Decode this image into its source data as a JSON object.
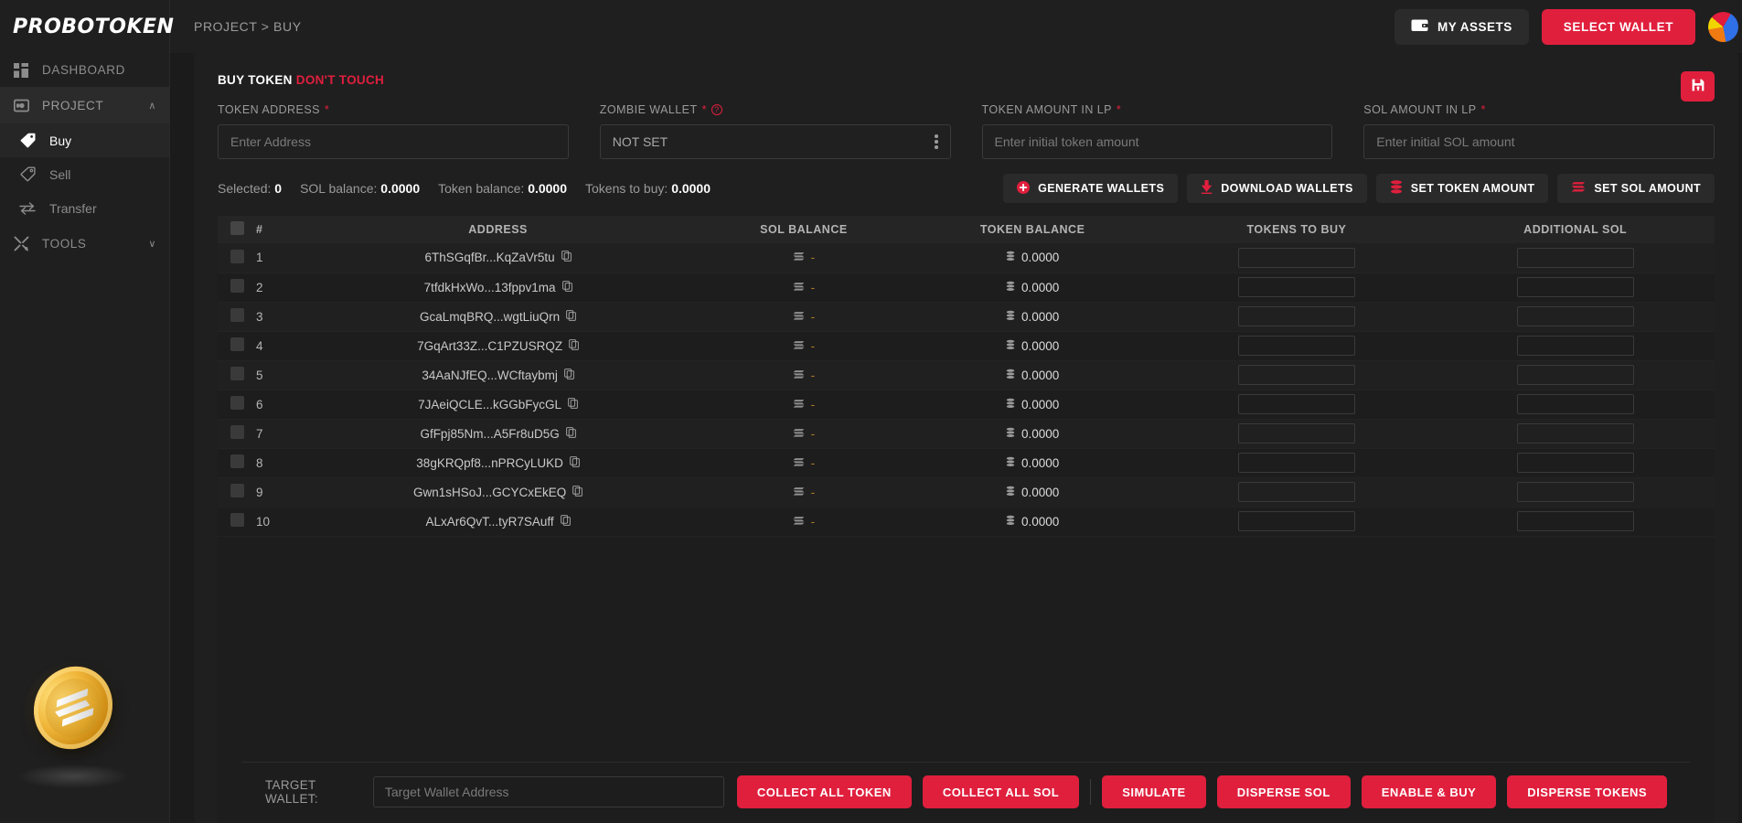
{
  "sidebar": {
    "logo": "PROBOTOKEN",
    "items": [
      {
        "label": "DASHBOARD",
        "icon": "grid-icon"
      },
      {
        "label": "PROJECT",
        "icon": "project-icon",
        "chevron": "∧"
      },
      {
        "label": "TOOLS",
        "icon": "tools-icon",
        "chevron": "∨"
      }
    ],
    "sub_items": [
      {
        "label": "Buy",
        "icon": "tag-filled-icon"
      },
      {
        "label": "Sell",
        "icon": "tag-outline-icon"
      },
      {
        "label": "Transfer",
        "icon": "transfer-icon"
      }
    ],
    "coin": "solana-coin-graphic"
  },
  "topbar": {
    "breadcrumb": "PROJECT > BUY",
    "my_assets_label": "MY ASSETS",
    "select_wallet_label": "SELECT WALLET"
  },
  "panel": {
    "title": "BUY TOKEN",
    "title_warning": "DON'T TOUCH",
    "save_icon": "save-floppy-icon"
  },
  "form": {
    "token_address": {
      "label": "TOKEN ADDRESS",
      "required": "*",
      "placeholder": "Enter Address",
      "value": ""
    },
    "zombie_wallet": {
      "label": "ZOMBIE WALLET",
      "required": "*",
      "value": "NOT SET",
      "help": "?"
    },
    "token_amount_lp": {
      "label": "TOKEN AMOUNT IN LP",
      "required": "*",
      "placeholder": "Enter initial token amount",
      "value": ""
    },
    "sol_amount_lp": {
      "label": "SOL AMOUNT IN LP",
      "required": "*",
      "placeholder": "Enter initial SOL amount",
      "value": ""
    }
  },
  "stats": {
    "selected_label": "Selected:",
    "selected_value": "0",
    "sol_balance_label": "SOL balance:",
    "sol_balance_value": "0.0000",
    "token_balance_label": "Token balance:",
    "token_balance_value": "0.0000",
    "tokens_to_buy_label": "Tokens to buy:",
    "tokens_to_buy_value": "0.0000"
  },
  "tool_buttons": [
    {
      "label": "GENERATE WALLETS",
      "icon": "plus-circle-icon"
    },
    {
      "label": "DOWNLOAD WALLETS",
      "icon": "download-icon"
    },
    {
      "label": "SET TOKEN AMOUNT",
      "icon": "coins-icon"
    },
    {
      "label": "SET SOL AMOUNT",
      "icon": "solana-icon"
    }
  ],
  "table": {
    "columns": [
      "#",
      "ADDRESS",
      "SOL BALANCE",
      "TOKEN BALANCE",
      "TOKENS TO BUY",
      "ADDITIONAL SOL"
    ],
    "rows": [
      {
        "num": "1",
        "address": "6ThSGqfBr...KqZaVr5tu",
        "sol_balance": "-",
        "token_balance": "0.0000",
        "tokens_to_buy": "",
        "additional_sol": ""
      },
      {
        "num": "2",
        "address": "7tfdkHxWo...13fppv1ma",
        "sol_balance": "-",
        "token_balance": "0.0000",
        "tokens_to_buy": "",
        "additional_sol": ""
      },
      {
        "num": "3",
        "address": "GcaLmqBRQ...wgtLiuQrn",
        "sol_balance": "-",
        "token_balance": "0.0000",
        "tokens_to_buy": "",
        "additional_sol": ""
      },
      {
        "num": "4",
        "address": "7GqArt33Z...C1PZUSRQZ",
        "sol_balance": "-",
        "token_balance": "0.0000",
        "tokens_to_buy": "",
        "additional_sol": ""
      },
      {
        "num": "5",
        "address": "34AaNJfEQ...WCftaybmj",
        "sol_balance": "-",
        "token_balance": "0.0000",
        "tokens_to_buy": "",
        "additional_sol": ""
      },
      {
        "num": "6",
        "address": "7JAeiQCLE...kGGbFycGL",
        "sol_balance": "-",
        "token_balance": "0.0000",
        "tokens_to_buy": "",
        "additional_sol": ""
      },
      {
        "num": "7",
        "address": "GfFpj85Nm...A5Fr8uD5G",
        "sol_balance": "-",
        "token_balance": "0.0000",
        "tokens_to_buy": "",
        "additional_sol": ""
      },
      {
        "num": "8",
        "address": "38gKRQpf8...nPRCyLUKD",
        "sol_balance": "-",
        "token_balance": "0.0000",
        "tokens_to_buy": "",
        "additional_sol": ""
      },
      {
        "num": "9",
        "address": "Gwn1sHSoJ...GCYCxEkEQ",
        "sol_balance": "-",
        "token_balance": "0.0000",
        "tokens_to_buy": "",
        "additional_sol": ""
      },
      {
        "num": "10",
        "address": "ALxAr6QvT...tyR7SAuff",
        "sol_balance": "-",
        "token_balance": "0.0000",
        "tokens_to_buy": "",
        "additional_sol": ""
      }
    ]
  },
  "footer": {
    "target_wallet_label": "TARGET WALLET:",
    "target_wallet_placeholder": "Target Wallet Address",
    "target_wallet_value": "",
    "buttons_left": [
      {
        "label": "COLLECT ALL TOKEN"
      },
      {
        "label": "COLLECT ALL SOL"
      }
    ],
    "buttons_right": [
      {
        "label": "SIMULATE"
      },
      {
        "label": "DISPERSE SOL"
      },
      {
        "label": "ENABLE & BUY"
      },
      {
        "label": "DISPERSE TOKENS"
      }
    ]
  },
  "colors": {
    "accent_red": "#e01f3d",
    "panel_bg": "#1f1f1f",
    "page_bg": "#1b1b1b"
  }
}
